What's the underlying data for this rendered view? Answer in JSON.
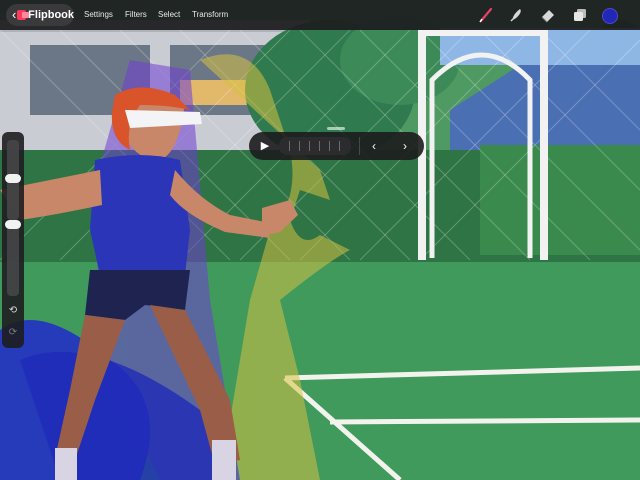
{
  "app": {
    "name": "Flipbook",
    "back_icon": "chevron-left-icon"
  },
  "menu": [
    {
      "label": "Settings"
    },
    {
      "label": "Filters"
    },
    {
      "label": "Select"
    },
    {
      "label": "Transform"
    }
  ],
  "tools": {
    "brush": "brush-icon",
    "smudge": "smudge-icon",
    "eraser": "eraser-icon",
    "layers": "layers-icon",
    "current_color": "#2128b5"
  },
  "sidebar": {
    "undo_icon": "undo-icon",
    "redo_icon": "redo-icon"
  },
  "playback": {
    "play_icon": "play-icon",
    "prev_icon": "chevron-left-icon",
    "next_icon": "chevron-right-icon"
  }
}
